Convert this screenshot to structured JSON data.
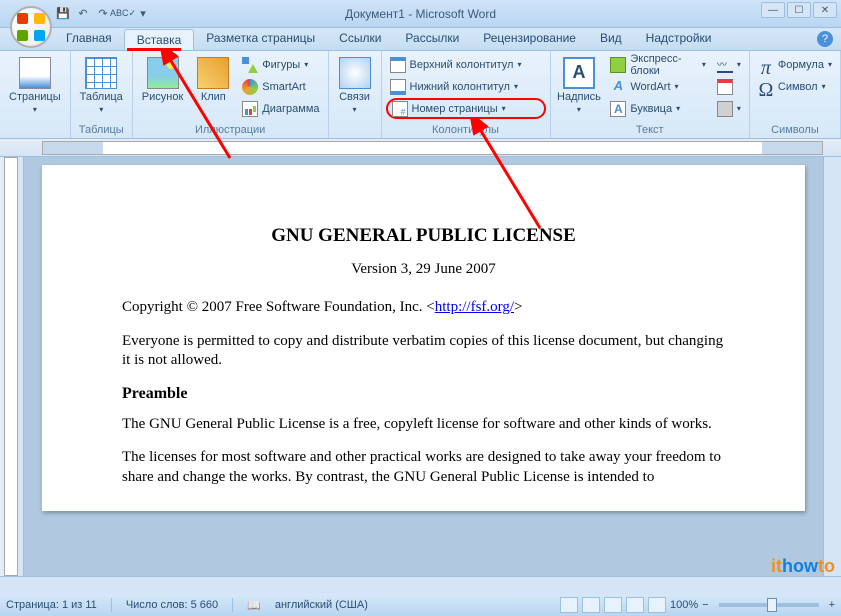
{
  "window": {
    "title": "Документ1 - Microsoft Word"
  },
  "tabs": {
    "home": "Главная",
    "insert": "Вставка",
    "layout": "Разметка страницы",
    "refs": "Ссылки",
    "mail": "Рассылки",
    "review": "Рецензирование",
    "view": "Вид",
    "addins": "Надстройки"
  },
  "ribbon": {
    "pages": {
      "label": "Страницы",
      "group": "Таблицы"
    },
    "table": {
      "label": "Таблица",
      "group": "Таблицы"
    },
    "picture": {
      "label": "Рисунок"
    },
    "clip": {
      "label": "Клип"
    },
    "shapes": {
      "label": "Фигуры"
    },
    "smartart": {
      "label": "SmartArt"
    },
    "chart": {
      "label": "Диаграмма"
    },
    "illus_group": "Иллюстрации",
    "links": {
      "label": "Связи"
    },
    "header": {
      "label": "Верхний колонтитул"
    },
    "footer": {
      "label": "Нижний колонтитул"
    },
    "pagenum": {
      "label": "Номер страницы"
    },
    "hf_group": "Колонтитулы",
    "textbox": {
      "label": "Надпись"
    },
    "parts": {
      "label": "Экспресс-блоки"
    },
    "wordart": {
      "label": "WordArt"
    },
    "dropcap": {
      "label": "Буквица"
    },
    "sig": {
      "label": ""
    },
    "date": {
      "label": ""
    },
    "obj": {
      "label": ""
    },
    "text_group": "Текст",
    "formula": {
      "label": "Формула"
    },
    "symbol": {
      "label": "Символ"
    },
    "sym_group": "Символы"
  },
  "doc": {
    "h1": "GNU GENERAL PUBLIC LICENSE",
    "version": "Version 3, 29 June 2007",
    "copyright_pre": "Copyright © 2007 Free Software Foundation, Inc. <",
    "copyright_link": "http://fsf.org/",
    "copyright_post": ">",
    "p1": "Everyone is permitted to copy and distribute verbatim copies of this license document, but changing it is not allowed.",
    "h2": "Preamble",
    "p2": "The GNU General Public License is a free, copyleft license for software and other kinds of works.",
    "p3": "The licenses for most software and other practical works are designed to take away your freedom to share and change the works. By contrast, the GNU General Public License is intended to"
  },
  "status": {
    "page": "Страница: 1 из 11",
    "words": "Число слов: 5 660",
    "lang": "английский (США)",
    "zoom": "100%"
  }
}
